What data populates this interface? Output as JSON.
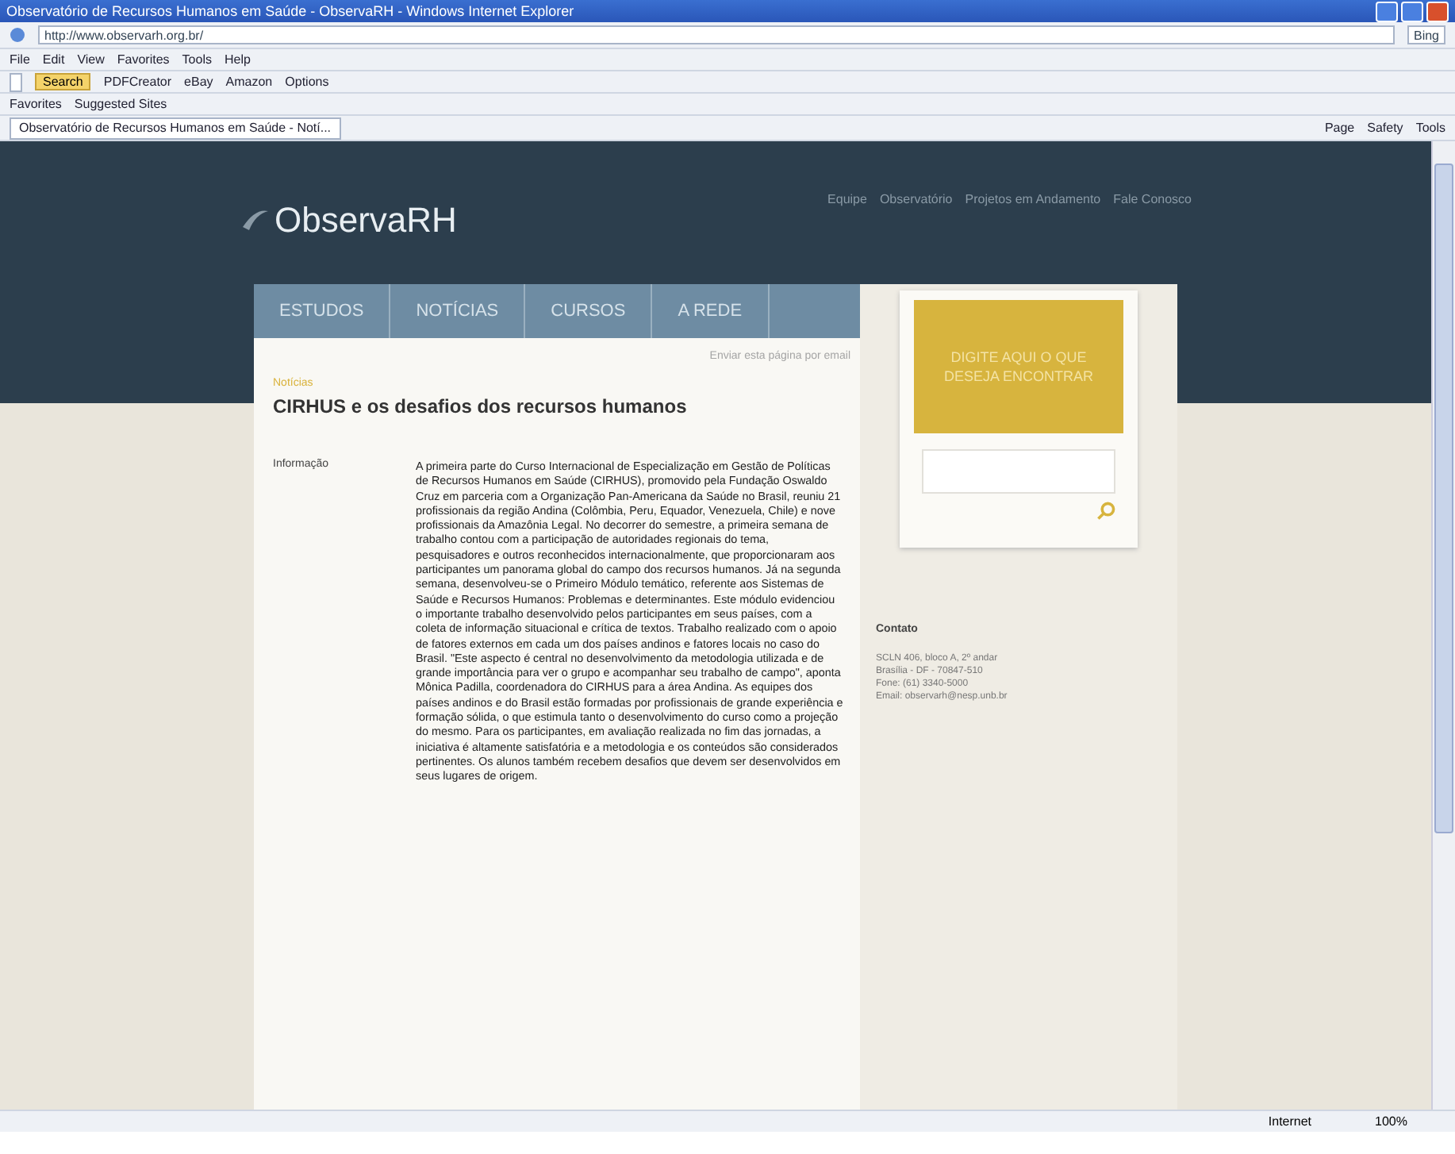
{
  "window": {
    "title": "Observatório de Recursos Humanos em Saúde - ObservaRH - Windows Internet Explorer"
  },
  "address_bar": {
    "url": "http://www.observarh.org.br/",
    "search_placeholder": "Bing"
  },
  "menu": [
    "File",
    "Edit",
    "View",
    "Favorites",
    "Tools",
    "Help"
  ],
  "toolbar": {
    "search_button": "Search",
    "items": [
      "PDFCreator",
      "eBay",
      "Amazon",
      "Options"
    ]
  },
  "favorites_bar": {
    "label": "Favorites",
    "items": [
      "Suggested Sites"
    ]
  },
  "tab": {
    "title": "Observatório de Recursos Humanos em Saúde - Notí...",
    "commands": [
      "Page",
      "Safety",
      "Tools"
    ]
  },
  "site": {
    "logo": "ObservaRH",
    "top_links": [
      "Equipe",
      "Observatório",
      "Projetos em Andamento",
      "Fale Conosco"
    ],
    "nav": [
      {
        "label": "ESTUDOS",
        "selected": false
      },
      {
        "label": "NOTÍCIAS",
        "selected": false
      },
      {
        "label": "CURSOS",
        "selected": false
      },
      {
        "label": "A REDE",
        "selected": false
      }
    ],
    "email_link": "Enviar esta página por email",
    "category": "Notícias",
    "headline": "CIRHUS e os desafios dos recursos humanos",
    "side_label": "Informação",
    "body": "A primeira parte do Curso Internacional de Especialização em Gestão de Políticas de Recursos Humanos em Saúde (CIRHUS), promovido pela Fundação Oswaldo Cruz em parceria com a Organização Pan-Americana da Saúde no Brasil, reuniu 21 profissionais da região Andina (Colômbia, Peru, Equador, Venezuela, Chile) e nove profissionais da Amazônia Legal. No decorrer do semestre, a primeira semana de trabalho contou com a participação de autoridades regionais do tema, pesquisadores e outros reconhecidos internacionalmente, que proporcionaram aos participantes um panorama global do campo dos recursos humanos. Já na segunda semana, desenvolveu-se o Primeiro Módulo temático, referente aos Sistemas de Saúde e Recursos Humanos: Problemas e determinantes. Este módulo evidenciou o importante trabalho desenvolvido pelos participantes em seus países, com a coleta de informação situacional e crítica de textos. Trabalho realizado com o apoio de fatores externos em cada um dos países andinos e fatores locais no caso do Brasil. \"Este aspecto é central no desenvolvimento da metodologia utilizada e de grande importância para ver o grupo e acompanhar seu trabalho de campo\", aponta Mônica Padilla, coordenadora do CIRHUS para a área Andina. As equipes dos países andinos e do Brasil estão formadas por profissionais de grande experiência e formação sólida, o que estimula tanto o desenvolvimento do curso como a projeção do mesmo. Para os participantes, em avaliação realizada no fim das jornadas, a iniciativa é altamente satisfatória e a metodologia e os conteúdos são considerados pertinentes. Os alunos também recebem desafios que devem ser desenvolvidos em seus lugares de origem.",
    "search_prompt": "DIGITE AQUI O QUE DESEJA ENCONTRAR",
    "contact": {
      "title": "Contato",
      "lines": [
        "SCLN 406, bloco A, 2º andar",
        "Brasília - DF - 70847-510",
        "Fone: (61) 3340-5000",
        "Email: observarh@nesp.unb.br"
      ]
    }
  },
  "status_bar": {
    "zone": "Internet",
    "zoom": "100%"
  }
}
